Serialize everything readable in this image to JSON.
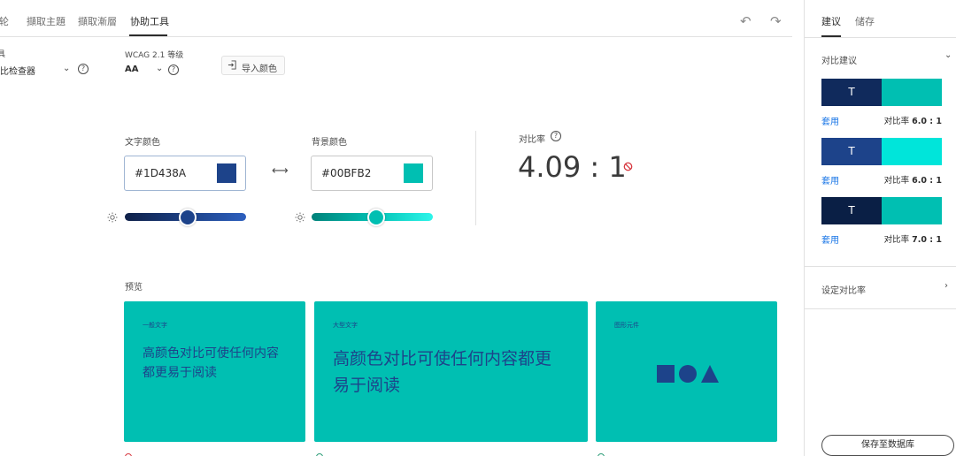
{
  "tabs": [
    {
      "label": "色轮"
    },
    {
      "label": "擷取主題"
    },
    {
      "label": "擷取漸層"
    },
    {
      "label": "协助工具"
    }
  ],
  "toolbar": {
    "tool_label": "工具",
    "tool_value": "对比检查器",
    "wcag_label": "WCAG 2.1 等级",
    "wcag_value": "AA",
    "import_label": "导入颜色"
  },
  "text_color": {
    "label": "文字颜色",
    "hex": "#1D438A",
    "swatch": "#1D438A",
    "brightness": 0.52
  },
  "background_color": {
    "label": "背景颜色",
    "hex": "#00BFB2",
    "swatch": "#00BFB2",
    "brightness": 0.53
  },
  "contrast": {
    "label": "对比率",
    "value": "4.09 : 1"
  },
  "preview": {
    "label": "预览",
    "cards": [
      {
        "title": "一般文字",
        "body": "高颜色对比可使任何内容都更易于阅读"
      },
      {
        "title": "大型文字",
        "body": "高颜色对比可使任何内容都更易于阅读"
      },
      {
        "title": "图形元件",
        "body": ""
      }
    ]
  },
  "panel": {
    "tabs": [
      {
        "label": "建议"
      },
      {
        "label": "储存"
      }
    ],
    "suggest_header": "对比建议",
    "suggestions": [
      {
        "glyph": "T",
        "fg": "#102A5C",
        "bg": "#00BFB2",
        "apply": "套用",
        "ratio_label": "对比率",
        "ratio": "6.0 : 1"
      },
      {
        "glyph": "T",
        "fg": "#1D438A",
        "bg": "#00E5DA",
        "apply": "套用",
        "ratio_label": "对比率",
        "ratio": "6.0 : 1"
      },
      {
        "glyph": "T",
        "fg": "#0A1F45",
        "bg": "#00BFB2",
        "apply": "套用",
        "ratio_label": "对比率",
        "ratio": "7.0 : 1"
      }
    ],
    "set_ratio": "设定对比率",
    "save_label": "保存至数据库"
  },
  "colors": {
    "accent": "#1473E6",
    "fail": "#D7373F",
    "pass": "#2D9D78"
  }
}
